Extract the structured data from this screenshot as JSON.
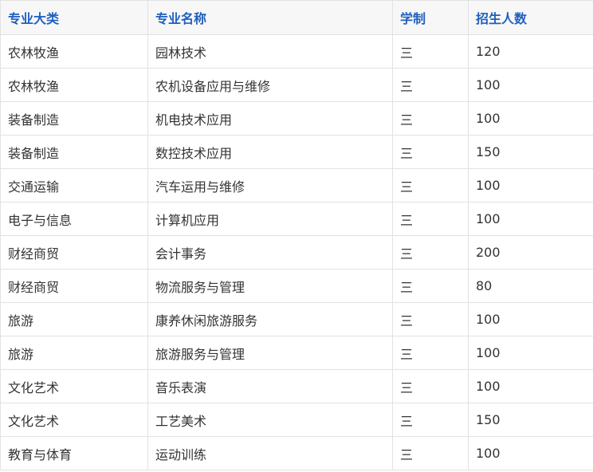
{
  "table": {
    "headers": [
      "专业大类",
      "专业名称",
      "学制",
      "招生人数"
    ],
    "rows": [
      [
        "农林牧渔",
        "园林技术",
        "三",
        "120"
      ],
      [
        "农林牧渔",
        "农机设备应用与维修",
        "三",
        "100"
      ],
      [
        "装备制造",
        "机电技术应用",
        "三",
        "100"
      ],
      [
        "装备制造",
        "数控技术应用",
        "三",
        "150"
      ],
      [
        "交通运输",
        "汽车运用与维修",
        "三",
        "100"
      ],
      [
        "电子与信息",
        "计算机应用",
        "三",
        "100"
      ],
      [
        "财经商贸",
        "会计事务",
        "三",
        "200"
      ],
      [
        "财经商贸",
        "物流服务与管理",
        "三",
        "80"
      ],
      [
        "旅游",
        "康养休闲旅游服务",
        "三",
        "100"
      ],
      [
        "旅游",
        "旅游服务与管理",
        "三",
        "100"
      ],
      [
        "文化艺术",
        "音乐表演",
        "三",
        "100"
      ],
      [
        "文化艺术",
        "工艺美术",
        "三",
        "150"
      ],
      [
        "教育与体育",
        "运动训练",
        "三",
        "100"
      ]
    ]
  },
  "colors": {
    "header_text": "#1f5fbf",
    "header_bg": "#f7f7f7",
    "border": "#e2e2e2",
    "body_text": "#333333"
  }
}
